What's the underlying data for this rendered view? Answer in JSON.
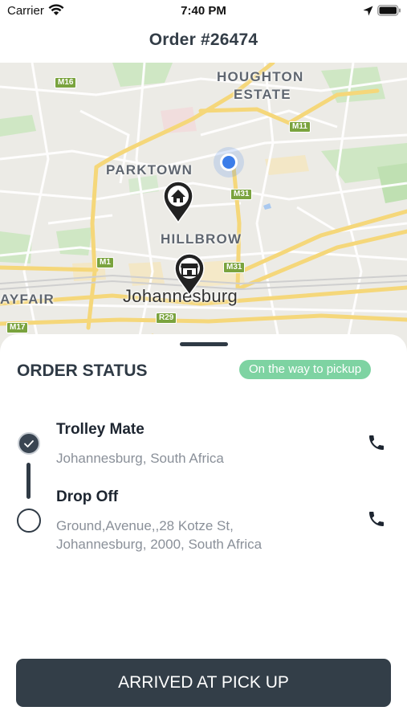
{
  "status_bar": {
    "carrier": "Carrier",
    "time": "7:40 PM",
    "icons": [
      "wifi-icon",
      "location-arrow-icon",
      "battery-icon"
    ]
  },
  "header": {
    "title": "Order #26474"
  },
  "map": {
    "area_labels": [
      "HOUGHTON",
      "ESTATE",
      "PARKTOWN",
      "HILLBROW",
      "AYFAIR"
    ],
    "city_label": "Johannesburg",
    "route_badges": [
      "M16",
      "M11",
      "M31",
      "M1",
      "M31",
      "M17",
      "R29"
    ],
    "markers": [
      "home-pin-icon",
      "store-pin-icon",
      "current-location-dot"
    ]
  },
  "order_status": {
    "title": "ORDER STATUS",
    "status_badge": "On the way to pickup",
    "status_color": "#7ed3a2",
    "stops": [
      {
        "name": "Trolley Mate",
        "address_line1": "Johannesburg, South Africa",
        "address_line2": "",
        "done": true
      },
      {
        "name": "Drop Off",
        "address_line1": "Ground,Avenue,,28 Kotze St,",
        "address_line2": "Johannesburg, 2000, South Africa",
        "done": false
      }
    ]
  },
  "action_button": {
    "label": "ARRIVED AT PICK UP",
    "color": "#333e48"
  }
}
